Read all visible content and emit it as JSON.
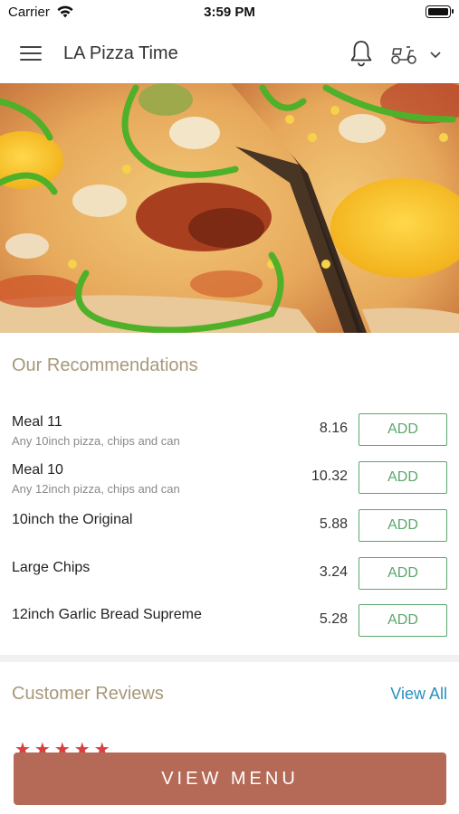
{
  "status_bar": {
    "carrier": "Carrier",
    "time": "3:59 PM"
  },
  "header": {
    "title": "LA Pizza Time",
    "icons": [
      "menu-icon",
      "bell-icon",
      "scooter-icon",
      "chevron-down-icon"
    ]
  },
  "hero": {
    "image": "pizza-photo"
  },
  "recommendations": {
    "title": "Our Recommendations",
    "add_label": "ADD",
    "items": [
      {
        "name": "Meal 11",
        "description": "Any 10inch pizza, chips and can",
        "price": "8.16"
      },
      {
        "name": "Meal 10",
        "description": "Any 12inch pizza, chips and can",
        "price": "10.32"
      },
      {
        "name": "10inch the Original",
        "description": "",
        "price": "5.88"
      },
      {
        "name": "Large Chips",
        "description": "",
        "price": "3.24"
      },
      {
        "name": "12inch Garlic Bread Supreme",
        "description": "",
        "price": "5.28"
      }
    ]
  },
  "reviews": {
    "title": "Customer Reviews",
    "view_all": "View All",
    "rating_stars": 5
  },
  "footer": {
    "view_menu": "VIEW MENU"
  },
  "colors": {
    "accent_title": "#a7987a",
    "add_green": "#5aa76b",
    "link_blue": "#2b8fbd",
    "cta_brown": "#b56a57",
    "star_red": "#d94040"
  }
}
